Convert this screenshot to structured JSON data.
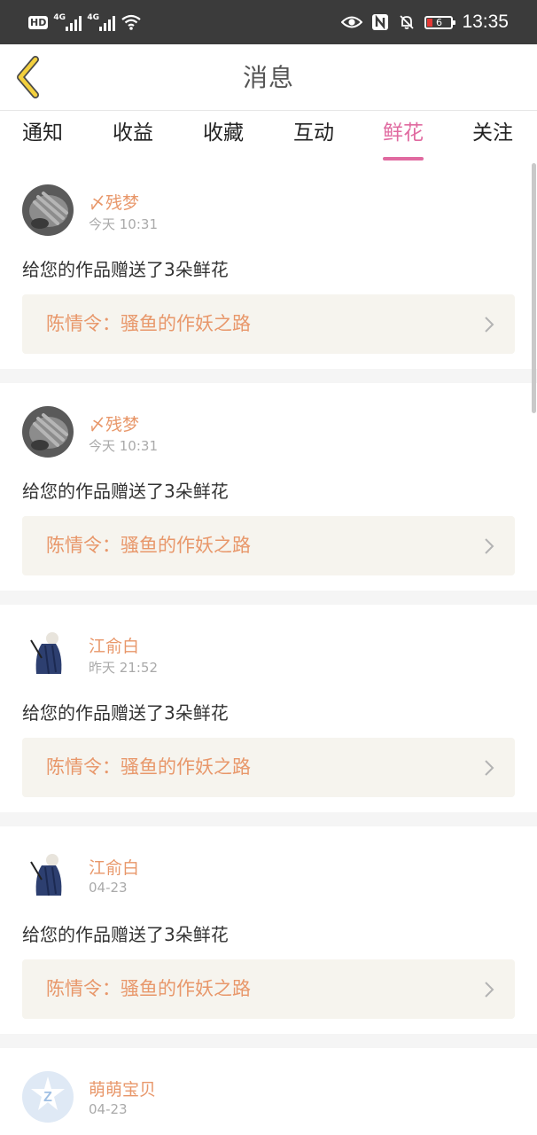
{
  "status_bar": {
    "hd": "HD",
    "sim1": "4G",
    "sim2": "4G",
    "battery": "6",
    "time": "13:35"
  },
  "header": {
    "title": "消息"
  },
  "tabs": [
    {
      "label": "通知",
      "active": false
    },
    {
      "label": "收益",
      "active": false
    },
    {
      "label": "收藏",
      "active": false
    },
    {
      "label": "互动",
      "active": false
    },
    {
      "label": "鲜花",
      "active": true
    },
    {
      "label": "关注",
      "active": false
    }
  ],
  "messages": [
    {
      "user": "〆残梦",
      "time": "今天 10:31",
      "text": "给您的作品赠送了3朵鲜花",
      "work": "陈情令：骚鱼的作妖之路",
      "avatar": "gray-photo"
    },
    {
      "user": "〆残梦",
      "time": "今天 10:31",
      "text": "给您的作品赠送了3朵鲜花",
      "work": "陈情令：骚鱼的作妖之路",
      "avatar": "gray-photo"
    },
    {
      "user": "江俞白",
      "time": "昨天 21:52",
      "text": "给您的作品赠送了3朵鲜花",
      "work": "陈情令：骚鱼的作妖之路",
      "avatar": "blue-robed-figure"
    },
    {
      "user": "江俞白",
      "time": "04-23",
      "text": "给您的作品赠送了3朵鲜花",
      "work": "陈情令：骚鱼的作妖之路",
      "avatar": "blue-robed-figure"
    },
    {
      "user": "萌萌宝贝",
      "time": "04-23",
      "text": "",
      "work": "",
      "avatar": "default-z-logo"
    }
  ],
  "colors": {
    "accent": "#e06aa0",
    "username": "#e8976a",
    "back_arrow": "#f3d03e"
  }
}
